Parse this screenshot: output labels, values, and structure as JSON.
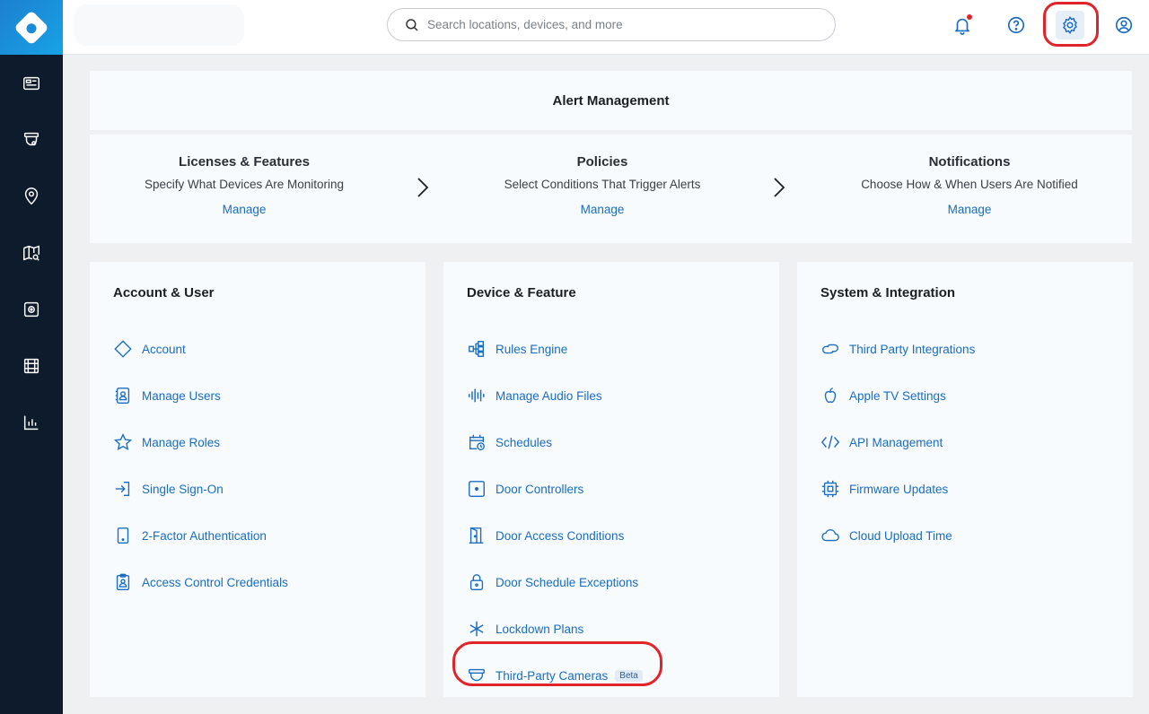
{
  "topbar": {
    "search_placeholder": "Search locations, devices, and more"
  },
  "alert_management": {
    "title": "Alert Management",
    "steps": [
      {
        "title": "Licenses & Features",
        "desc": "Specify What Devices Are Monitoring",
        "link": "Manage"
      },
      {
        "title": "Policies",
        "desc": "Select Conditions That Trigger Alerts",
        "link": "Manage"
      },
      {
        "title": "Notifications",
        "desc": "Choose How & When Users Are Notified",
        "link": "Manage"
      }
    ]
  },
  "columns": [
    {
      "title": "Account & User",
      "items": [
        {
          "label": "Account",
          "icon": "diamond-icon"
        },
        {
          "label": "Manage Users",
          "icon": "users-book-icon"
        },
        {
          "label": "Manage Roles",
          "icon": "star-icon"
        },
        {
          "label": "Single Sign-On",
          "icon": "sign-in-icon"
        },
        {
          "label": "2-Factor Authentication",
          "icon": "tablet-icon"
        },
        {
          "label": "Access Control Credentials",
          "icon": "badge-icon"
        }
      ]
    },
    {
      "title": "Device & Feature",
      "items": [
        {
          "label": "Rules Engine",
          "icon": "flow-icon"
        },
        {
          "label": "Manage Audio Files",
          "icon": "waveform-icon"
        },
        {
          "label": "Schedules",
          "icon": "calendar-clock-icon"
        },
        {
          "label": "Door Controllers",
          "icon": "controller-icon"
        },
        {
          "label": "Door Access Conditions",
          "icon": "door-icon"
        },
        {
          "label": "Door Schedule Exceptions",
          "icon": "lock-icon"
        },
        {
          "label": "Lockdown Plans",
          "icon": "asterisk-icon"
        },
        {
          "label": "Third-Party Cameras",
          "icon": "dome-camera-icon",
          "badge": "Beta"
        }
      ]
    },
    {
      "title": "System & Integration",
      "items": [
        {
          "label": "Third Party Integrations",
          "icon": "link-icon"
        },
        {
          "label": "Apple TV Settings",
          "icon": "apple-icon"
        },
        {
          "label": "API Management",
          "icon": "code-icon"
        },
        {
          "label": "Firmware Updates",
          "icon": "chip-icon"
        },
        {
          "label": "Cloud Upload Time",
          "icon": "cloud-icon"
        }
      ]
    }
  ],
  "colors": {
    "sidebar": "#0e1b2c",
    "accent_link": "#1a6cc0",
    "highlight_ring": "#e0242a",
    "logo": "#1c8ad6"
  }
}
